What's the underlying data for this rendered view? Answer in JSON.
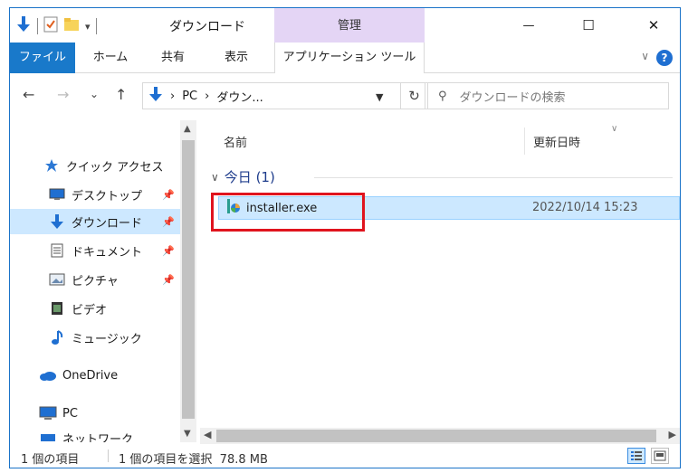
{
  "window": {
    "title": "ダウンロード",
    "context_tab": "管理",
    "controls": {
      "minimize": "—",
      "maximize": "☐",
      "close": "✕"
    }
  },
  "ribbon": {
    "tabs": [
      "ファイル",
      "ホーム",
      "共有",
      "表示",
      "アプリケーション ツール"
    ],
    "help": "?",
    "expand": "∨"
  },
  "nav": {
    "back": "←",
    "forward": "→",
    "recent": "⌄",
    "up": "↑",
    "breadcrumb": [
      "PC",
      "ダウン..."
    ],
    "separator": "›",
    "refresh": "↻",
    "search_placeholder": "ダウンロードの検索"
  },
  "sidebar": {
    "items": [
      {
        "label": "クイック アクセス",
        "icon": "star-icon"
      },
      {
        "label": "デスクトップ",
        "icon": "desktop-icon",
        "pinned": true
      },
      {
        "label": "ダウンロード",
        "icon": "download-icon",
        "pinned": true,
        "selected": true
      },
      {
        "label": "ドキュメント",
        "icon": "document-icon",
        "pinned": true
      },
      {
        "label": "ピクチャ",
        "icon": "picture-icon",
        "pinned": true
      },
      {
        "label": "ビデオ",
        "icon": "video-icon"
      },
      {
        "label": "ミュージック",
        "icon": "music-icon"
      },
      {
        "label": "OneDrive",
        "icon": "cloud-icon"
      },
      {
        "label": "PC",
        "icon": "pc-icon"
      },
      {
        "label": "ネットワーク",
        "icon": "network-icon"
      }
    ]
  },
  "content": {
    "columns": {
      "name": "名前",
      "modified": "更新日時"
    },
    "group": {
      "label": "今日 (1)"
    },
    "files": [
      {
        "name": "installer.exe",
        "modified": "2022/10/14 15:23"
      }
    ]
  },
  "status": {
    "item_count": "1 個の項目",
    "selection": "1 個の項目を選択  78.8 MB"
  },
  "colors": {
    "accent": "#1979ca",
    "selection": "#cce8ff",
    "context_tab": "#e4d5f5",
    "highlight_box": "#e0141e"
  }
}
